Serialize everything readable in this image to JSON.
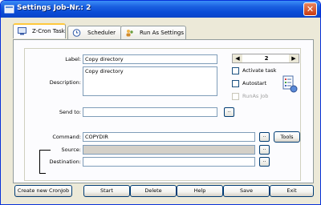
{
  "window": {
    "title": "Settings Job-Nr.: 2",
    "close_glyph": "✕"
  },
  "tabs": [
    {
      "label": "Z-Cron Task",
      "icon": "monitor-icon"
    },
    {
      "label": "Scheduler",
      "icon": "clock-icon"
    },
    {
      "label": "Run As Settings",
      "icon": "users-icon"
    }
  ],
  "form": {
    "label_caption": "Label:",
    "label_value": "Copy directory",
    "description_caption": "Description:",
    "description_value": "Copy directory",
    "send_to_caption": "Send to:",
    "send_to_value": "",
    "command_caption": "Command:",
    "command_value": "COPYDIR",
    "source_caption": "Source:",
    "source_value": "",
    "destination_caption": "Destination:",
    "destination_value": "",
    "browse_label": "..",
    "tools_label": "Tools"
  },
  "pager": {
    "prev": "◀",
    "value": "2",
    "next": "▶"
  },
  "options": {
    "activate_task": {
      "label": "Activate task",
      "checked": false,
      "enabled": true
    },
    "autostart": {
      "label": "Autostart",
      "checked": false,
      "enabled": true
    },
    "run_as_job": {
      "label": "RunAs Job",
      "checked": false,
      "enabled": false
    }
  },
  "buttons": {
    "create": "Create new CronJob",
    "start": "Start",
    "delete": "Delete",
    "help": "Help",
    "save": "Save",
    "exit": "Exit"
  },
  "colors": {
    "title_bar": "#0a4bd6",
    "window_bg": "#ece9d8",
    "tab_accent": "#ffc83c"
  }
}
